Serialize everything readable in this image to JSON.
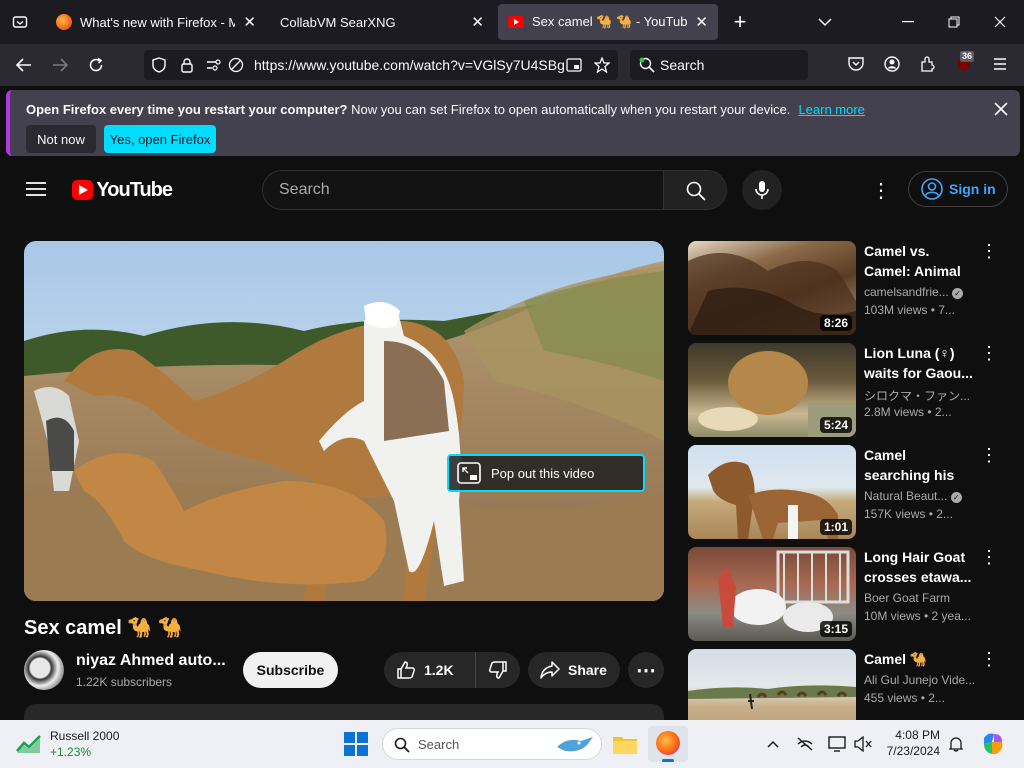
{
  "browser": {
    "tabs": [
      {
        "title": "What's new with Firefox - More"
      },
      {
        "title": "CollabVM SearXNG"
      },
      {
        "title": "Sex camel 🐪 🐪 - YouTube",
        "active": true
      }
    ],
    "url": "https://www.youtube.com/watch?v=VGlSy7U4SBg",
    "search_placeholder": "Search",
    "extension_badge": "36"
  },
  "notification": {
    "bold": "Open Firefox every time you restart your computer?",
    "text": " Now you can set Firefox to open automatically when you restart your device.",
    "link": "Learn more",
    "btn_no": "Not now",
    "btn_yes": "Yes, open Firefox"
  },
  "youtube": {
    "logo_text": "YouTube",
    "search_placeholder": "Search",
    "sign_in": "Sign in",
    "popout_label": "Pop out this video",
    "video_title": "Sex camel 🐪 🐪",
    "channel_name": "niyaz Ahmed auto...",
    "subscribers": "1.22K subscribers",
    "subscribe": "Subscribe",
    "likes": "1.2K",
    "share": "Share",
    "recommendations": [
      {
        "title": "Camel vs. Camel: Animal Attack...",
        "channel": "camelsandfrie...",
        "verified": true,
        "meta": "103M views  •  7...",
        "duration": "8:26"
      },
      {
        "title": "Lion Luna (♀) waits for Gaou...",
        "channel": "シロクマ・ファン...",
        "verified": false,
        "meta": "2.8M views  •  2...",
        "duration": "5:24"
      },
      {
        "title": "Camel searching his partner",
        "channel": "Natural Beaut...",
        "verified": true,
        "meta": "157K views  •  2...",
        "duration": "1:01"
      },
      {
        "title": "Long Hair Goat crosses etawa...",
        "channel": "Boer Goat Farm",
        "verified": false,
        "meta": "10M views  •  2 yea...",
        "duration": "3:15"
      },
      {
        "title": "Camel 🐪",
        "channel": "Ali Gul Junejo Vide...",
        "verified": false,
        "meta": "455 views  •  2...",
        "duration": ""
      }
    ]
  },
  "taskbar": {
    "stock_name": "Russell 2000",
    "stock_change": "+1.23%",
    "search_placeholder": "Search",
    "time": "4:08 PM",
    "date": "7/23/2024"
  },
  "colors": {
    "accent_cyan": "#00ddff",
    "yt_red": "#ff0000",
    "notif_border": "#b833e1",
    "link_blue": "#3ea6ff"
  }
}
